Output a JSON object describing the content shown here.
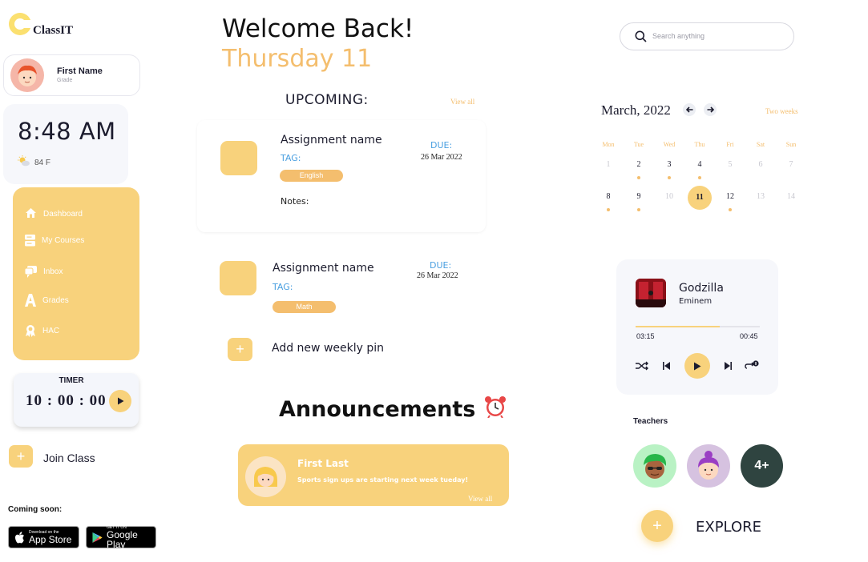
{
  "app": {
    "name": "ClassIT"
  },
  "profile": {
    "name": "First Name",
    "grade": "Grade"
  },
  "clock": {
    "time": "8:48 AM",
    "temperature": "84 F"
  },
  "nav": {
    "items": [
      {
        "label": "Dashboard",
        "icon": "home-icon"
      },
      {
        "label": "My Courses",
        "icon": "courses-icon"
      },
      {
        "label": "Inbox",
        "icon": "inbox-icon"
      },
      {
        "label": "Grades",
        "icon": "grades-icon"
      },
      {
        "label": "HAC",
        "icon": "award-icon"
      }
    ]
  },
  "timer": {
    "label": "TIMER",
    "value": "10 : 00 : 00"
  },
  "join": {
    "label": "Join Class"
  },
  "stores": {
    "heading": "Coming soon:",
    "app_store": {
      "small": "Download on the",
      "big": "App Store"
    },
    "google_play": {
      "small": "GET IT ON",
      "big": "Google Play"
    }
  },
  "header": {
    "welcome": "Welcome Back!",
    "day": "Thursday 11"
  },
  "upcoming": {
    "title": "UPCOMING:",
    "view_all": "View all",
    "assignments": [
      {
        "name": "Assignment name",
        "tag_label": "TAG:",
        "subject": "English",
        "due_label": "DUE:",
        "due_date": "26 Mar 2022",
        "notes_label": "Notes:"
      },
      {
        "name": "Assignment name",
        "tag_label": "TAG:",
        "subject": "Math",
        "due_label": "DUE:",
        "due_date": "26 Mar 2022"
      }
    ],
    "add_pin_label": "Add new weekly pin"
  },
  "announcements": {
    "title": "Announcements",
    "items": [
      {
        "author": "First Last",
        "message": "Sports sign ups are starting next week tueday!",
        "view_all": "View all"
      }
    ]
  },
  "search": {
    "placeholder": "Search anything"
  },
  "calendar": {
    "month": "March, 2022",
    "range_label": "Two weeks",
    "weekdays": [
      "Mon",
      "Tue",
      "Wed",
      "Thu",
      "Fri",
      "Sat",
      "Sun"
    ],
    "days": [
      {
        "n": "1",
        "faded": true,
        "dot": false
      },
      {
        "n": "2",
        "faded": false,
        "dot": true
      },
      {
        "n": "3",
        "faded": false,
        "dot": true
      },
      {
        "n": "4",
        "faded": false,
        "dot": true
      },
      {
        "n": "5",
        "faded": true,
        "dot": false
      },
      {
        "n": "6",
        "faded": true,
        "dot": false
      },
      {
        "n": "7",
        "faded": true,
        "dot": false
      },
      {
        "n": "8",
        "faded": false,
        "dot": true
      },
      {
        "n": "9",
        "faded": false,
        "dot": true
      },
      {
        "n": "10",
        "faded": true,
        "dot": false
      },
      {
        "n": "11",
        "faded": false,
        "dot": false,
        "selected": true
      },
      {
        "n": "12",
        "faded": false,
        "dot": true
      },
      {
        "n": "13",
        "faded": true,
        "dot": false
      },
      {
        "n": "14",
        "faded": true,
        "dot": false
      }
    ]
  },
  "player": {
    "title": "Godzilla",
    "artist": "Eminem",
    "elapsed": "03:15",
    "remaining": "00:45",
    "progress": 0.68
  },
  "teachers": {
    "label": "Teachers",
    "more": "4+"
  },
  "explore": {
    "label": "EXPLORE"
  },
  "colors": {
    "accent": "#f8d27c",
    "accent_dark": "#f4be6e",
    "link_blue": "#4a9fe0",
    "text": "#1c1c2e"
  }
}
